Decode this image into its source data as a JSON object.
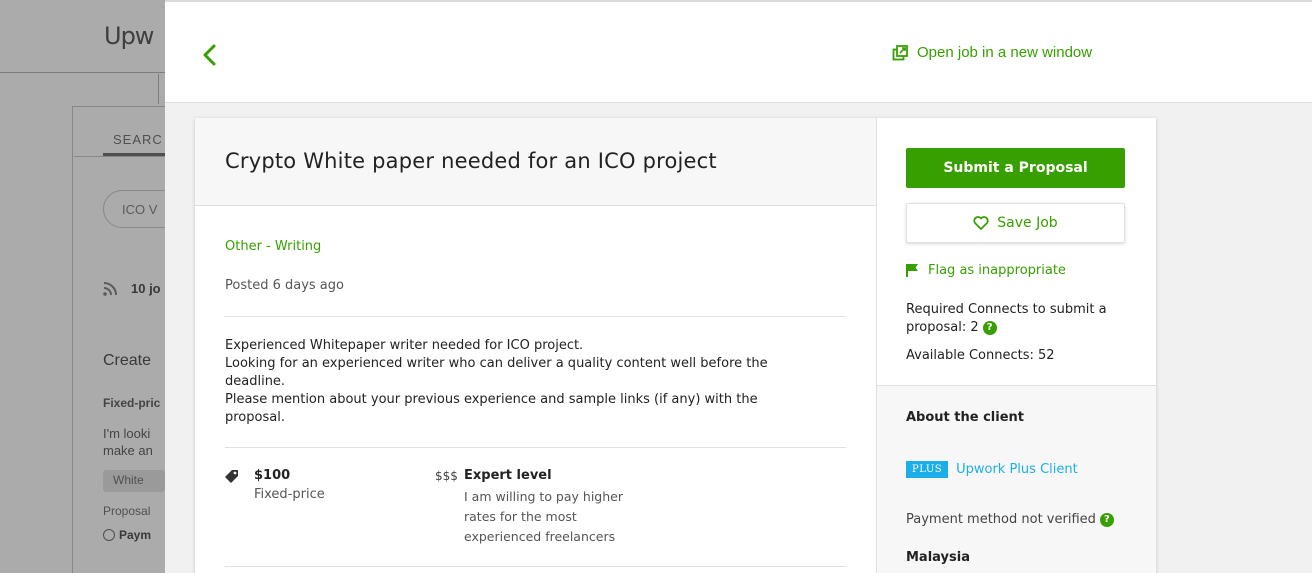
{
  "background": {
    "logo": "Upw",
    "search_label": "SEARC",
    "search_value": "ICO V",
    "jobs_count": "10 jo",
    "create_text": "Create",
    "fixed_text": "Fixed-pric",
    "desc_line1": "I'm looki",
    "desc_line2": "make an",
    "tag": "White",
    "proposal": "Proposal",
    "payment": "Paym"
  },
  "header": {
    "open_link": "Open job in a new window"
  },
  "job": {
    "title": "Crypto White paper needed for an ICO project",
    "category": "Other - Writing",
    "posted": "Posted 6 days ago",
    "description": [
      "Experienced Whitepaper writer needed for ICO project.",
      "Looking for an experienced writer who can deliver a quality content well before the",
      "deadline.",
      "Please mention about your previous experience and sample links (if any) with the",
      "proposal."
    ],
    "price": "$100",
    "price_type": "Fixed-price",
    "level_symbol": "$$$",
    "level": "Expert level",
    "level_desc": "I am willing to pay higher rates for the most experienced freelancers"
  },
  "sidebar": {
    "submit_label": "Submit a Proposal",
    "save_label": "Save Job",
    "flag_label": "Flag as inappropriate",
    "connects_required": "Required Connects to submit a proposal: 2",
    "connects_available": "Available Connects: 52",
    "about_title": "About the client",
    "plus_badge": "PLUS",
    "plus_label": "Upwork Plus Client",
    "payment_status": "Payment method not verified",
    "country": "Malaysia"
  },
  "colors": {
    "brand_green": "#37a000",
    "plus_blue": "#1caee8"
  }
}
